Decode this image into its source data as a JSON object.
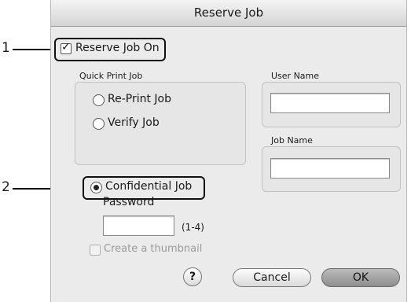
{
  "window": {
    "title": "Reserve Job"
  },
  "callouts": {
    "one": "1",
    "two": "2"
  },
  "reserve": {
    "label": "Reserve Job On",
    "checked": true
  },
  "quick_print": {
    "group_label": "Quick Print Job",
    "options": [
      {
        "label": "Re-Print Job",
        "selected": false
      },
      {
        "label": "Verify Job",
        "selected": false
      }
    ]
  },
  "user_name": {
    "label": "User Name",
    "value": ""
  },
  "job_name": {
    "label": "Job Name",
    "value": ""
  },
  "confidential": {
    "label": "Confidential Job",
    "selected": true
  },
  "password": {
    "label": "Password",
    "value": "",
    "hint": "(1-4)"
  },
  "thumbnail": {
    "label": "Create a thumbnail",
    "checked": false,
    "enabled": false
  },
  "buttons": {
    "help": "?",
    "cancel": "Cancel",
    "ok": "OK"
  }
}
